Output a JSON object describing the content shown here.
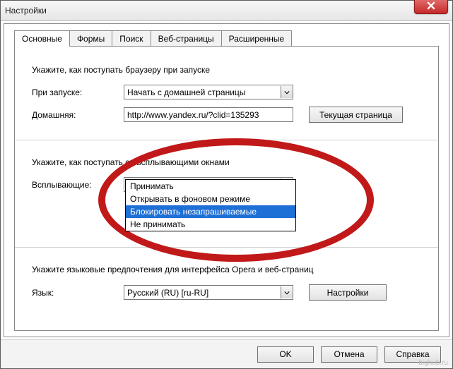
{
  "window": {
    "title": "Настройки"
  },
  "tabs": [
    "Основные",
    "Формы",
    "Поиск",
    "Веб-страницы",
    "Расширенные"
  ],
  "startup": {
    "heading": "Укажите, как поступать браузеру при запуске",
    "label": "При запуске:",
    "select_value": "Начать с домашней страницы",
    "home_label": "Домашняя:",
    "home_value": "http://www.yandex.ru/?clid=135293",
    "current_page_btn": "Текущая страница"
  },
  "popups": {
    "heading": "Укажите, как поступать со всплывающими окнами",
    "label": "Всплывающие:",
    "select_value": "Блокировать незапрашиваемые",
    "options": [
      "Принимать",
      "Открывать в фоновом режиме",
      "Блокировать незапрашиваемые",
      "Не принимать"
    ],
    "selected_index": 2
  },
  "lang": {
    "heading": "Укажите языковые предпочтения для интерфейса Opera и веб-страниц",
    "label": "Язык:",
    "select_value": "Русский (RU) [ru-RU]",
    "settings_btn": "Настройки"
  },
  "footer": {
    "ok": "OK",
    "cancel": "Отмена",
    "help": "Справка"
  },
  "watermark": "bighub.ru"
}
